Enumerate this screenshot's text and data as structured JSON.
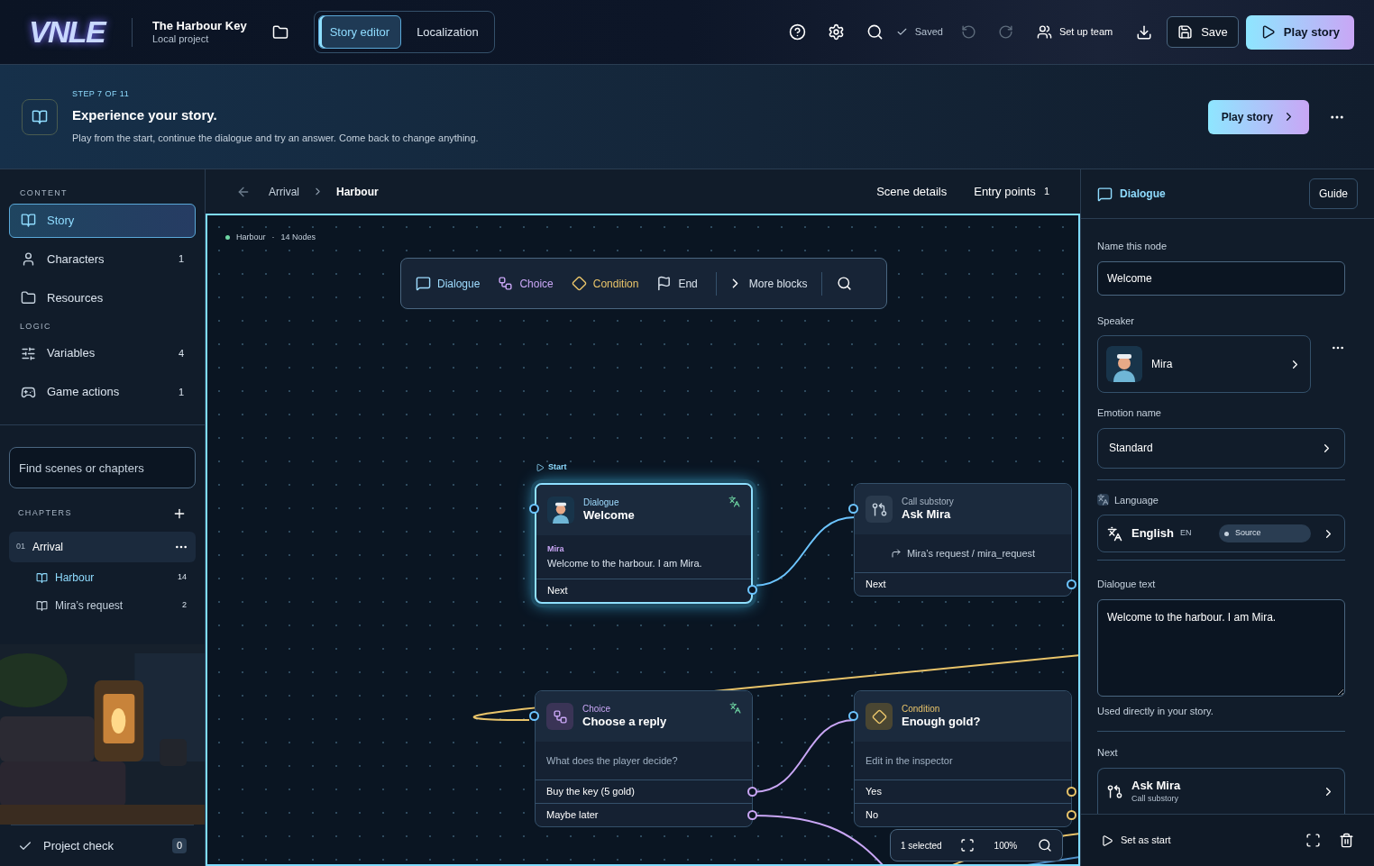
{
  "app": {
    "logo": "VNLE",
    "project_title": "The Harbour Key",
    "project_subtitle": "Local project"
  },
  "mode_tabs": [
    {
      "label": "Story editor",
      "selected": true
    },
    {
      "label": "Localization",
      "selected": false
    }
  ],
  "toolbar": {
    "saved": "Saved",
    "team": "Set up team",
    "save": "Save",
    "play": "Play story"
  },
  "banner": {
    "step": "STEP 7 OF 11",
    "title": "Experience your story.",
    "text": "Play from the start, continue the dialogue and try an answer. Come back to change anything.",
    "button": "Play story"
  },
  "sidebar": {
    "sections": [
      {
        "heading": "CONTENT",
        "items": [
          {
            "label": "Story",
            "selected": true
          },
          {
            "label": "Characters",
            "count": "1",
            "selected": false
          },
          {
            "label": "Resources",
            "selected": false
          }
        ]
      },
      {
        "heading": "LOGIC",
        "items": [
          {
            "label": "Variables",
            "count": "4",
            "selected": false
          },
          {
            "label": "Game actions",
            "count": "1",
            "selected": false
          }
        ]
      }
    ],
    "search": {
      "placeholder": "Find scenes or chapters"
    },
    "chapters_heading": "CHAPTERS",
    "chapters": [
      {
        "number": "01",
        "title": "Arrival",
        "children": [
          {
            "title": "Harbour",
            "count": "14",
            "selected": true
          },
          {
            "title": "Mira’s request",
            "count": "2",
            "selected": false
          }
        ]
      }
    ],
    "project_check": {
      "label": "Project check",
      "count": "0"
    }
  },
  "breadcrumb": [
    "Arrival",
    "Harbour"
  ],
  "scene_actions": [
    {
      "label": "Scene details"
    },
    {
      "label": "Entry points",
      "count": "1"
    }
  ],
  "canvas": {
    "scene": "Harbour",
    "separator": "·",
    "node_count": "14 Nodes",
    "start_label": "Start",
    "blocks": [
      {
        "kind": "dialogue",
        "label": "Dialogue"
      },
      {
        "kind": "choice",
        "label": "Choice"
      },
      {
        "kind": "condition",
        "label": "Condition"
      },
      {
        "kind": "end",
        "label": "End"
      },
      {
        "kind": "more",
        "label": "More blocks"
      }
    ],
    "nodes": [
      {
        "kind": "dialogue",
        "type_label": "Dialogue",
        "title": "Welcome",
        "selected": true,
        "speaker": "Mira",
        "text": "Welcome to the harbour. I am Mira.",
        "outputs": [
          "Next"
        ]
      },
      {
        "kind": "call",
        "type_label": "Call substory",
        "title": "Ask Mira",
        "selected": false,
        "target": "Mira’s request / mira_request",
        "outputs": [
          "Next"
        ]
      },
      {
        "kind": "choice",
        "type_label": "Choice",
        "title": "Choose a reply",
        "selected": false,
        "prompt": "What does the player decide?",
        "outputs": [
          "Buy the key (5 gold)",
          "Maybe later"
        ]
      },
      {
        "kind": "condition",
        "type_label": "Condition",
        "title": "Enough gold?",
        "selected": false,
        "prompt": "Edit in the inspector",
        "outputs": [
          "Yes",
          "No"
        ]
      }
    ],
    "status": {
      "selection": "1 selected",
      "zoom": "100%"
    }
  },
  "inspector": {
    "title": "Dialogue",
    "guide": "Guide",
    "name_label": "Name this node",
    "name_value": "Welcome",
    "speaker_label": "Speaker",
    "speaker": "Mira",
    "emotion_label": "Emotion name",
    "emotion": "Standard",
    "language_label": "Language",
    "language": "English",
    "language_code": "EN",
    "language_badge": "Source",
    "text_label": "Dialogue text",
    "text_value": "Welcome to the harbour. I am Mira.",
    "text_help": "Used directly in your story.",
    "next_label": "Next",
    "next_title": "Ask Mira",
    "next_subtitle": "Call substory",
    "set_start": "Set as start"
  }
}
